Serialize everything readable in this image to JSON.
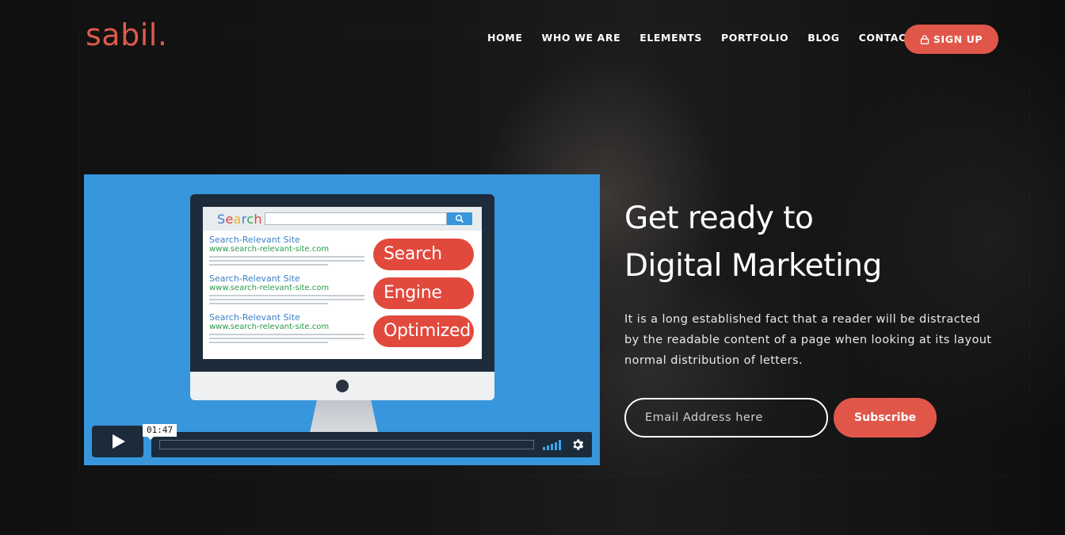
{
  "brand": {
    "logo": "sabil."
  },
  "nav": {
    "items": [
      "HOME",
      "WHO WE ARE",
      "ELEMENTS",
      "PORTFOLIO",
      "BLOG",
      "CONTACT"
    ],
    "signup_label": "SIGN UP"
  },
  "video": {
    "search_word": [
      "S",
      "e",
      "a",
      "r",
      "c",
      "h"
    ],
    "results": [
      {
        "title": "Search-Relevant Site",
        "url": "www.search-relevant-site.com"
      },
      {
        "title": "Search-Relevant Site",
        "url": "www.search-relevant-site.com"
      },
      {
        "title": "Search-Relevant Site",
        "url": "www.search-relevant-site.com"
      }
    ],
    "pills": [
      "Search",
      "Engine",
      "Optimized"
    ],
    "time": "01:47",
    "progress": 0
  },
  "hero": {
    "headline_line1": "Get ready to",
    "headline_line2": "Digital Marketing",
    "description": "It is a long established fact that a reader will be distracted by the readable content of a page when looking at its layout normal distribution of letters.",
    "email_placeholder": "Email Address here",
    "subscribe_label": "Subscribe"
  },
  "colors": {
    "accent": "#e0574a",
    "video_bg": "#3796dc"
  }
}
